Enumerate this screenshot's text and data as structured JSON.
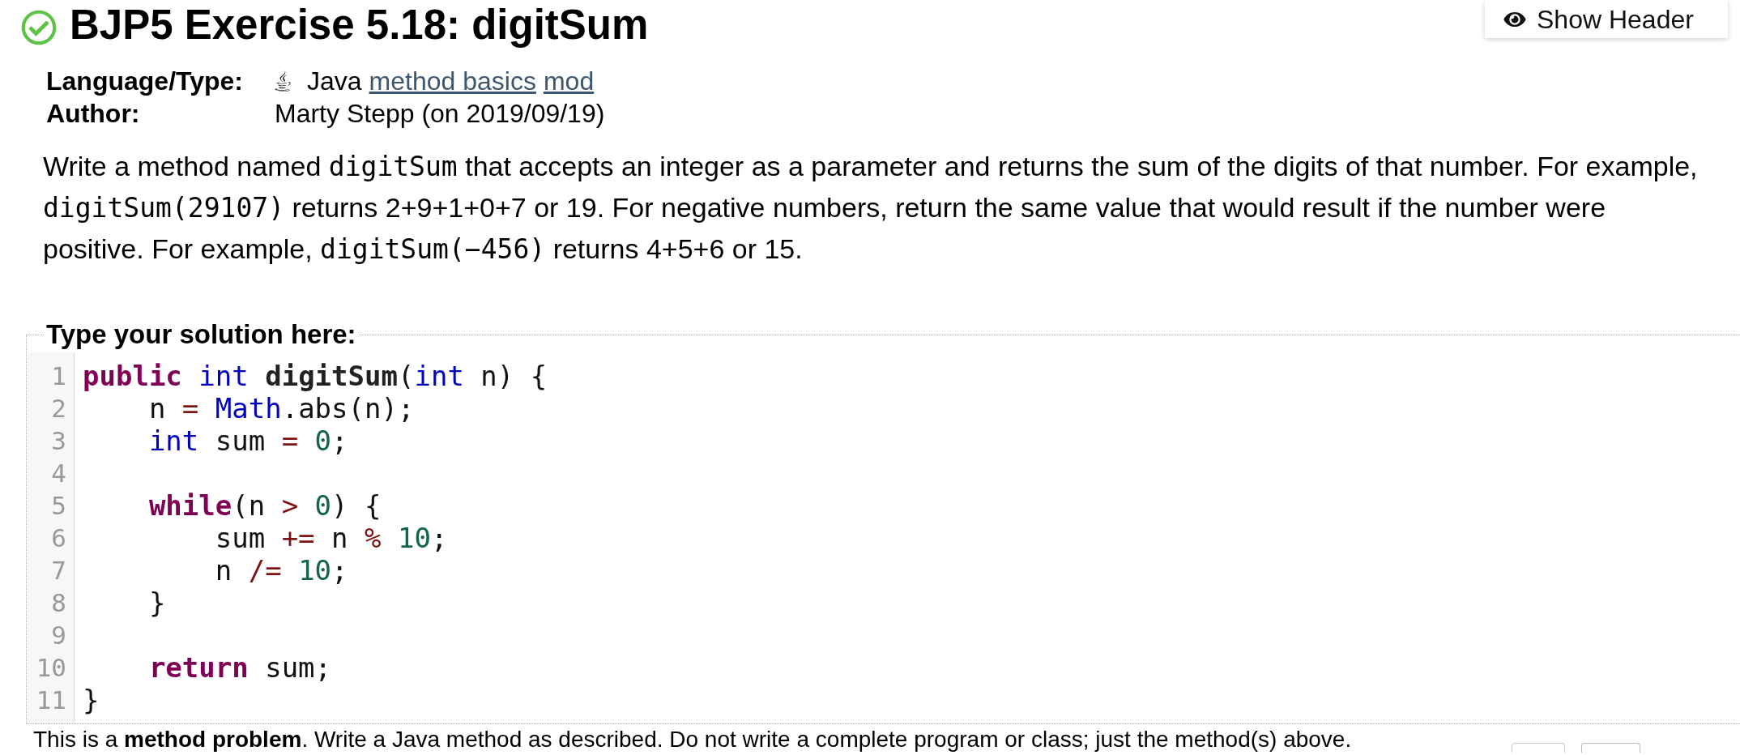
{
  "header": {
    "title": "BJP5 Exercise 5.18: digitSum",
    "solved": true
  },
  "show_header_button": {
    "label": "Show Header"
  },
  "meta": [
    {
      "kind": "language",
      "label": "Language/Type:",
      "value": [
        {
          "kind": "text",
          "text": "Java"
        },
        {
          "kind": "link",
          "text": "method basics"
        },
        {
          "kind": "link",
          "text": "mod"
        }
      ]
    },
    {
      "kind": "author",
      "label": "Author:",
      "value": [
        {
          "kind": "text",
          "text": "Marty Stepp (on 2019/09/19)"
        }
      ]
    }
  ],
  "description": [
    {
      "kind": "text",
      "text": "Write a method named "
    },
    {
      "kind": "code",
      "text": "digitSum"
    },
    {
      "kind": "text",
      "text": " that accepts an integer as a parameter and returns the sum of the digits of that number. For example, "
    },
    {
      "kind": "code",
      "text": "digitSum(29107)"
    },
    {
      "kind": "text",
      "text": " returns 2+9+1+0+7 or 19. For negative numbers, return the same value that would result if the number were positive. For example, "
    },
    {
      "kind": "code",
      "text": "digitSum(−456)"
    },
    {
      "kind": "text",
      "text": " returns 4+5+6 or 15."
    }
  ],
  "editor": {
    "legend": "Type your solution here:",
    "lines": [
      {
        "number": "1",
        "tokens": [
          {
            "kind": "keyword",
            "text": "public"
          },
          {
            "kind": "type",
            "text": " int"
          },
          {
            "kind": "def",
            "text": " digitSum"
          },
          {
            "kind": "plain",
            "text": "("
          },
          {
            "kind": "type",
            "text": "int"
          },
          {
            "kind": "plain",
            "text": " n) {"
          }
        ]
      },
      {
        "number": "2",
        "tokens": [
          {
            "kind": "plain",
            "text": "    n "
          },
          {
            "kind": "operator",
            "text": "="
          },
          {
            "kind": "type",
            "text": " Math"
          },
          {
            "kind": "plain",
            "text": ".abs(n);"
          }
        ]
      },
      {
        "number": "3",
        "tokens": [
          {
            "kind": "type",
            "text": "    int"
          },
          {
            "kind": "plain",
            "text": " sum "
          },
          {
            "kind": "operator",
            "text": "="
          },
          {
            "kind": "number",
            "text": " 0"
          },
          {
            "kind": "plain",
            "text": ";"
          }
        ]
      },
      {
        "number": "4"
      },
      {
        "number": "5",
        "tokens": [
          {
            "kind": "keyword",
            "text": "    while"
          },
          {
            "kind": "plain",
            "text": "(n "
          },
          {
            "kind": "operator",
            "text": ">"
          },
          {
            "kind": "number",
            "text": " 0"
          },
          {
            "kind": "plain",
            "text": ") {"
          }
        ]
      },
      {
        "number": "6",
        "tokens": [
          {
            "kind": "plain",
            "text": "        sum "
          },
          {
            "kind": "operator",
            "text": "+="
          },
          {
            "kind": "plain",
            "text": " n "
          },
          {
            "kind": "operator",
            "text": "%"
          },
          {
            "kind": "number",
            "text": " 10"
          },
          {
            "kind": "plain",
            "text": ";"
          }
        ]
      },
      {
        "number": "7",
        "tokens": [
          {
            "kind": "plain",
            "text": "        n "
          },
          {
            "kind": "operator",
            "text": "/="
          },
          {
            "kind": "number",
            "text": " 10"
          },
          {
            "kind": "plain",
            "text": ";"
          }
        ]
      },
      {
        "number": "8",
        "tokens": [
          {
            "kind": "plain",
            "text": "    }"
          }
        ]
      },
      {
        "number": "9"
      },
      {
        "number": "10",
        "tokens": [
          {
            "kind": "keyword",
            "text": "    return"
          },
          {
            "kind": "plain",
            "text": " sum;"
          }
        ]
      },
      {
        "number": "11",
        "tokens": [
          {
            "kind": "plain",
            "text": "}"
          }
        ]
      }
    ]
  },
  "footer": {
    "text": "This is a **method problem**. Write a Java method as described. Do not write a complete program or class; just the method(s) above."
  }
}
